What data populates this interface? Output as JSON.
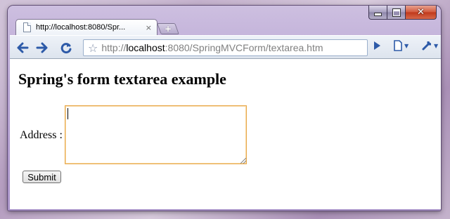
{
  "window": {
    "tab_title": "http://localhost:8080/Spr...",
    "tab_close": "×",
    "new_tab": "+"
  },
  "toolbar": {
    "url_scheme": "http://",
    "url_host": "localhost",
    "url_rest": ":8080/SpringMVCForm/textarea.htm"
  },
  "page": {
    "heading": "Spring's form textarea example",
    "address_label": "Address :",
    "address_value": "",
    "submit_label": "Submit"
  },
  "icons": {
    "back": "back-arrow-icon",
    "forward": "forward-arrow-icon",
    "reload": "reload-icon",
    "star": "bookmark-star-icon",
    "go": "go-arrow-icon",
    "page_menu": "page-menu-icon",
    "wrench_menu": "wrench-menu-icon"
  },
  "colors": {
    "focus_border": "#e8a84a",
    "chrome_blue": "#2d5aa8",
    "frame": "#b7a4d3"
  }
}
